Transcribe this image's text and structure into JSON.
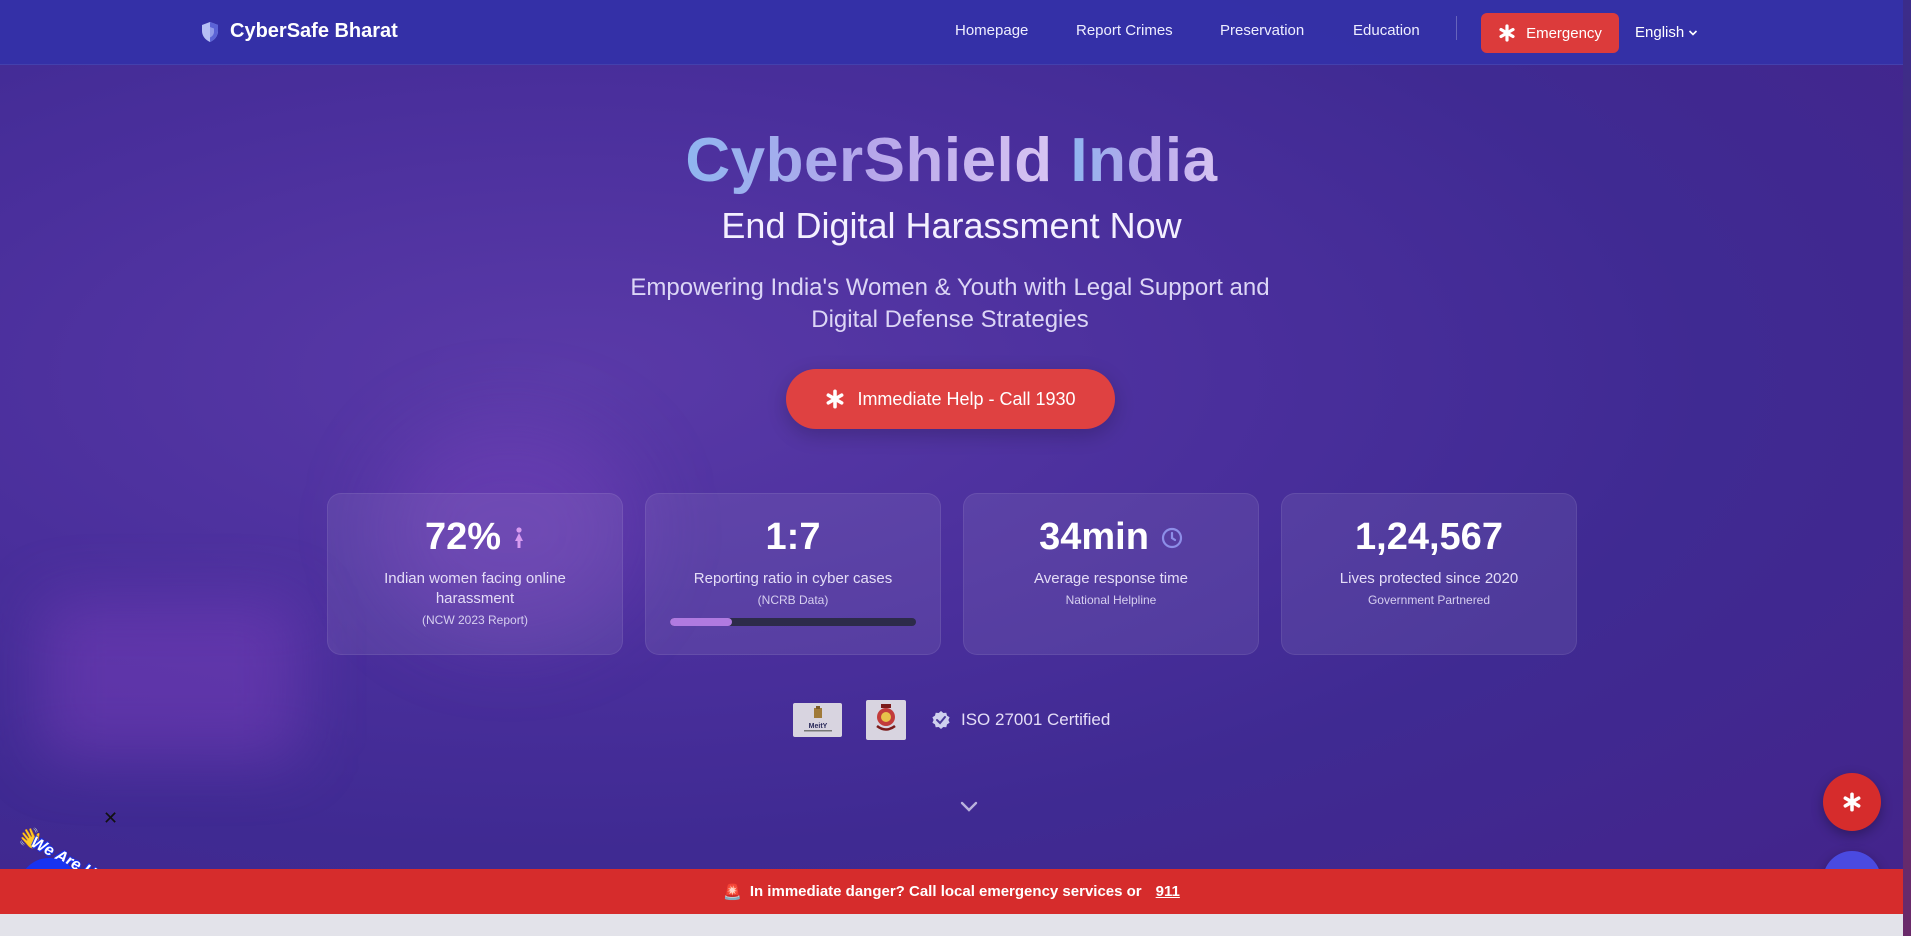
{
  "navbar": {
    "brand": "CyberSafe Bharat",
    "links": [
      "Homepage",
      "Report Crimes",
      "Preservation",
      "Education"
    ],
    "emergency_label": "Emergency",
    "language": "English"
  },
  "hero": {
    "title_part1": "CyberShield",
    "title_part2": "India",
    "subtitle": "End Digital Harassment Now",
    "description": "Empowering India's Women & Youth with Legal Support and Digital Defense Strategies",
    "cta_label": "Immediate Help - Call 1930"
  },
  "stats": [
    {
      "value": "72%",
      "label": "Indian women facing online harassment",
      "note": "(NCW 2023 Report)",
      "icon": "female-icon"
    },
    {
      "value": "1:7",
      "label": "Reporting ratio in cyber cases",
      "note": "(NCRB Data)",
      "progress": 0.25
    },
    {
      "value": "34min",
      "label": "Average response time",
      "note": "National Helpline",
      "icon": "clock-icon"
    },
    {
      "value": "1,24,567",
      "label": "Lives protected since 2020",
      "note": "Government Partnered"
    }
  ],
  "trust": {
    "logo1_text": "MeitY",
    "iso_label": "ISO 27001 Certified"
  },
  "danger_bar": {
    "icon": "🚨",
    "text": "In immediate danger? Call local emergency services or",
    "number": "911"
  },
  "chat_widget": {
    "label": "We Are Here!",
    "wave": "👋",
    "close": "✕"
  },
  "colors": {
    "accent_red": "#dc3b3b",
    "nav_bg": "#3430a8",
    "progress_fill": "#b07ae0",
    "chat_blue": "#1733f0"
  }
}
